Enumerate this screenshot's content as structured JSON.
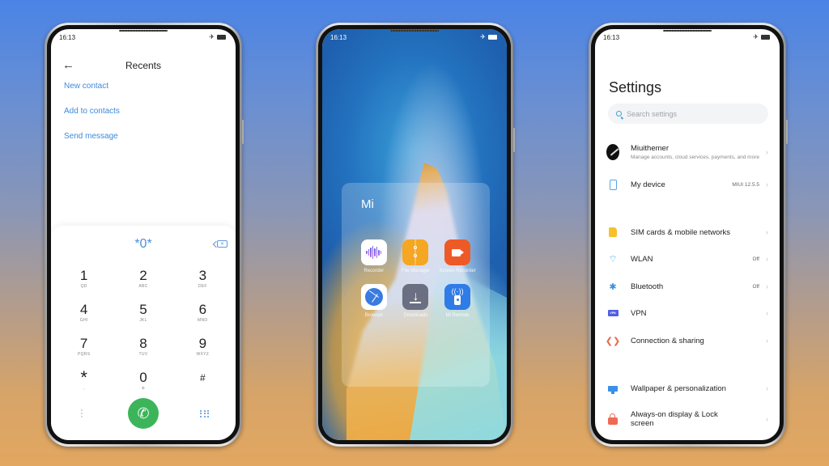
{
  "status_time": "16:13",
  "dialer": {
    "title": "Recents",
    "links": [
      "New contact",
      "Add to contacts",
      "Send message"
    ],
    "dialed_number": "*0*",
    "keys": [
      {
        "num": "1",
        "letters": "QD"
      },
      {
        "num": "2",
        "letters": "ABC"
      },
      {
        "num": "3",
        "letters": "DEF"
      },
      {
        "num": "4",
        "letters": "GHI"
      },
      {
        "num": "5",
        "letters": "JKL"
      },
      {
        "num": "6",
        "letters": "MNO"
      },
      {
        "num": "7",
        "letters": "PQRS"
      },
      {
        "num": "8",
        "letters": "TUV"
      },
      {
        "num": "9",
        "letters": "WXYZ"
      },
      {
        "num": "*",
        "letters": ","
      },
      {
        "num": "0",
        "letters": "+"
      },
      {
        "num": "#",
        "letters": ""
      }
    ],
    "icons": {
      "back": "←",
      "call": "✆",
      "more": "⋮"
    },
    "call_color": "#3cb55a",
    "accent": "#3e8ad9"
  },
  "home": {
    "folder_name": "Mi",
    "apps": [
      {
        "label": "Recorder",
        "icon": "recorder-icon"
      },
      {
        "label": "File Manager",
        "icon": "file-manager-icon"
      },
      {
        "label": "Screen Recorder",
        "icon": "screen-recorder-icon"
      },
      {
        "label": "Browser",
        "icon": "browser-icon"
      },
      {
        "label": "Downloads",
        "icon": "downloads-icon"
      },
      {
        "label": "Mi Remote",
        "icon": "mi-remote-icon"
      }
    ]
  },
  "settings": {
    "title": "Settings",
    "search_placeholder": "Search settings",
    "account": {
      "name": "Miuithemer",
      "sub": "Manage accounts, cloud services, payments, and more"
    },
    "my_device": {
      "label": "My device",
      "value": "MIUI 12.5.5"
    },
    "items": [
      {
        "label": "SIM cards & mobile networks",
        "value": ""
      },
      {
        "label": "WLAN",
        "value": "Off"
      },
      {
        "label": "Bluetooth",
        "value": "Off"
      },
      {
        "label": "VPN",
        "value": ""
      },
      {
        "label": "Connection & sharing",
        "value": ""
      }
    ],
    "items2": [
      {
        "label": "Wallpaper & personalization",
        "value": ""
      },
      {
        "label": "Always-on display & Lock screen",
        "value": ""
      }
    ],
    "vpn_badge": "VPN",
    "chevron": "›"
  }
}
